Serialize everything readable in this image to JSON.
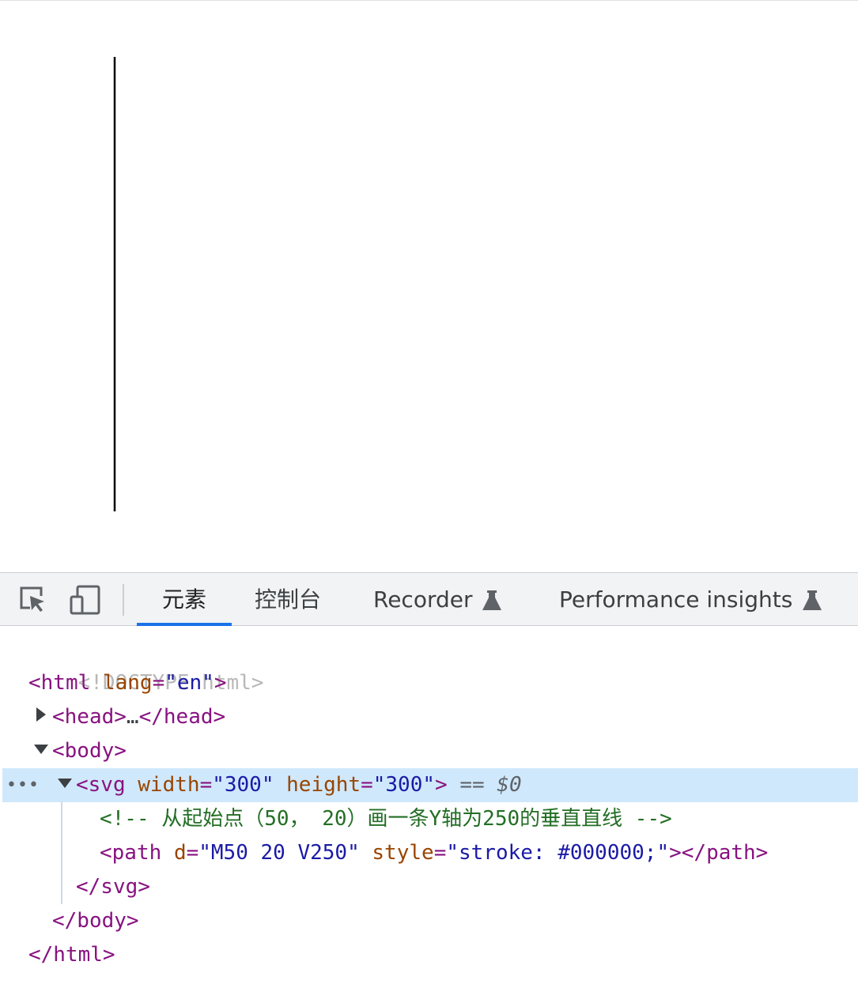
{
  "page": {
    "line_stroke": "#000000"
  },
  "devtools": {
    "toolbar": {
      "inspect_icon": "inspect-element-icon",
      "device_icon": "device-toggle-icon",
      "tabs": [
        {
          "label": "元素",
          "active": true
        },
        {
          "label": "控制台",
          "active": false
        },
        {
          "label": "Recorder",
          "experimental_icon": "flask-icon",
          "active": false
        },
        {
          "label": "Performance insights",
          "experimental_icon": "flask-icon",
          "active": false
        }
      ]
    },
    "dom_tree": {
      "doctype": "<!DOCTYPE html>",
      "html_open_tag": "<html",
      "html_lang_attr": "lang",
      "html_lang_val": "\"en\"",
      "html_open_close": ">",
      "head_open": "<head>",
      "head_ellipsis": "…",
      "head_close": "</head>",
      "body_open": "<body>",
      "svg_open_tag": "<svg",
      "svg_width_attr": "width",
      "svg_width_val": "\"300\"",
      "svg_height_attr": "height",
      "svg_height_val": "\"300\"",
      "svg_open_close": ">",
      "selected_marker": "== $0",
      "row_menu": "•••",
      "comment": "<!-- 从起始点（50， 20）画一条Y轴为250的垂直直线 -->",
      "path_open_tag": "<path",
      "path_d_attr": "d",
      "path_d_val": "\"M50 20 V250\"",
      "path_style_attr": "style",
      "path_style_val": "\"stroke: #000000;\"",
      "path_close": "></path>",
      "svg_close": "</svg>",
      "body_close": "</body>",
      "html_close": "</html>"
    },
    "colors": {
      "tag": "#881280",
      "attribute": "#994500",
      "value": "#1a1aa6",
      "comment": "#236e25",
      "selection": "#cfe8fc",
      "active_tab_underline": "#1a73e8"
    }
  }
}
